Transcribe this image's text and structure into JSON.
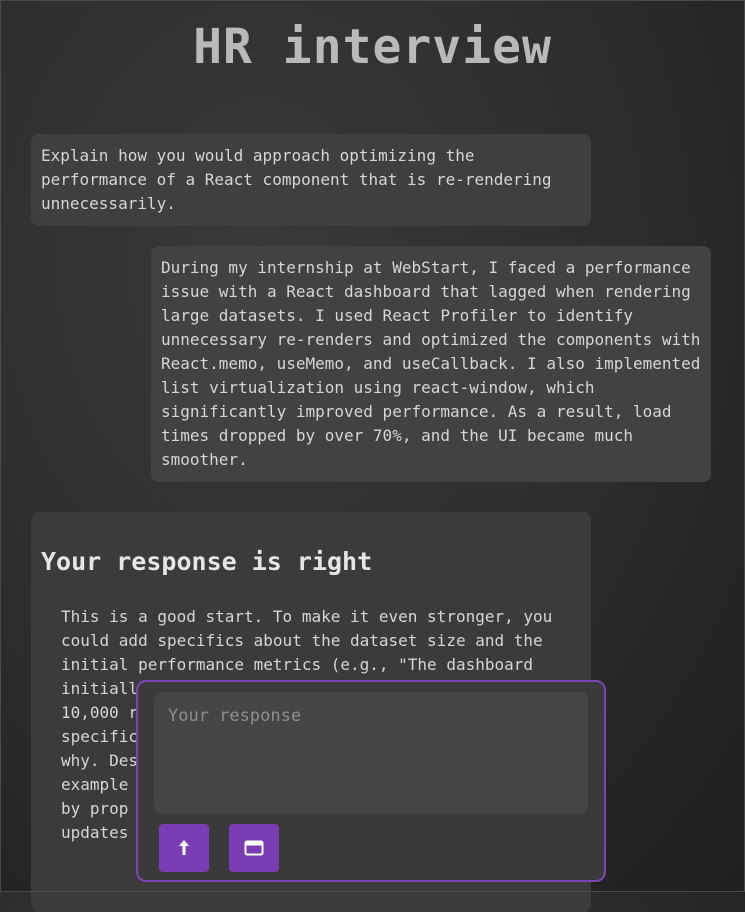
{
  "page": {
    "title": "HR interview"
  },
  "conversation": {
    "question": "Explain how you would approach optimizing the performance of a React component that is re-rendering unnecessarily.",
    "answer": "During my internship at WebStart, I faced a performance issue with a React dashboard that lagged when rendering large datasets. I used React Profiler to identify unnecessary re-renders and optimized the components with React.memo, useMemo, and useCallback. I also implemented list virtualization using react-window, which significantly improved performance. As a result, load times dropped by over 70%, and the UI became much smoother.",
    "feedback": {
      "heading": "Your response is right",
      "body": "This is a good start. To make it even stronger, you could add specifics about the dataset size and the initial performance metrics (e.g., \"The dashboard initially took 5 seconds to load a dataset with 10,000 rows\"). Mention which components were specifically causing the unnecessary re-renders and why. Describe how you used the React Profiler, for example by identifying the exact re-renders triggered by prop changes in child components and the state updates that caused them, and that sta"
    }
  },
  "composer": {
    "placeholder": "Your response",
    "value": "",
    "upload_icon": "arrow-up-icon",
    "window_icon": "window-icon"
  },
  "colors": {
    "accent": "#7a3db5",
    "composer_border": "#7b45b3",
    "bubble": "#3f3f3f",
    "title": "#b9b9b9"
  }
}
